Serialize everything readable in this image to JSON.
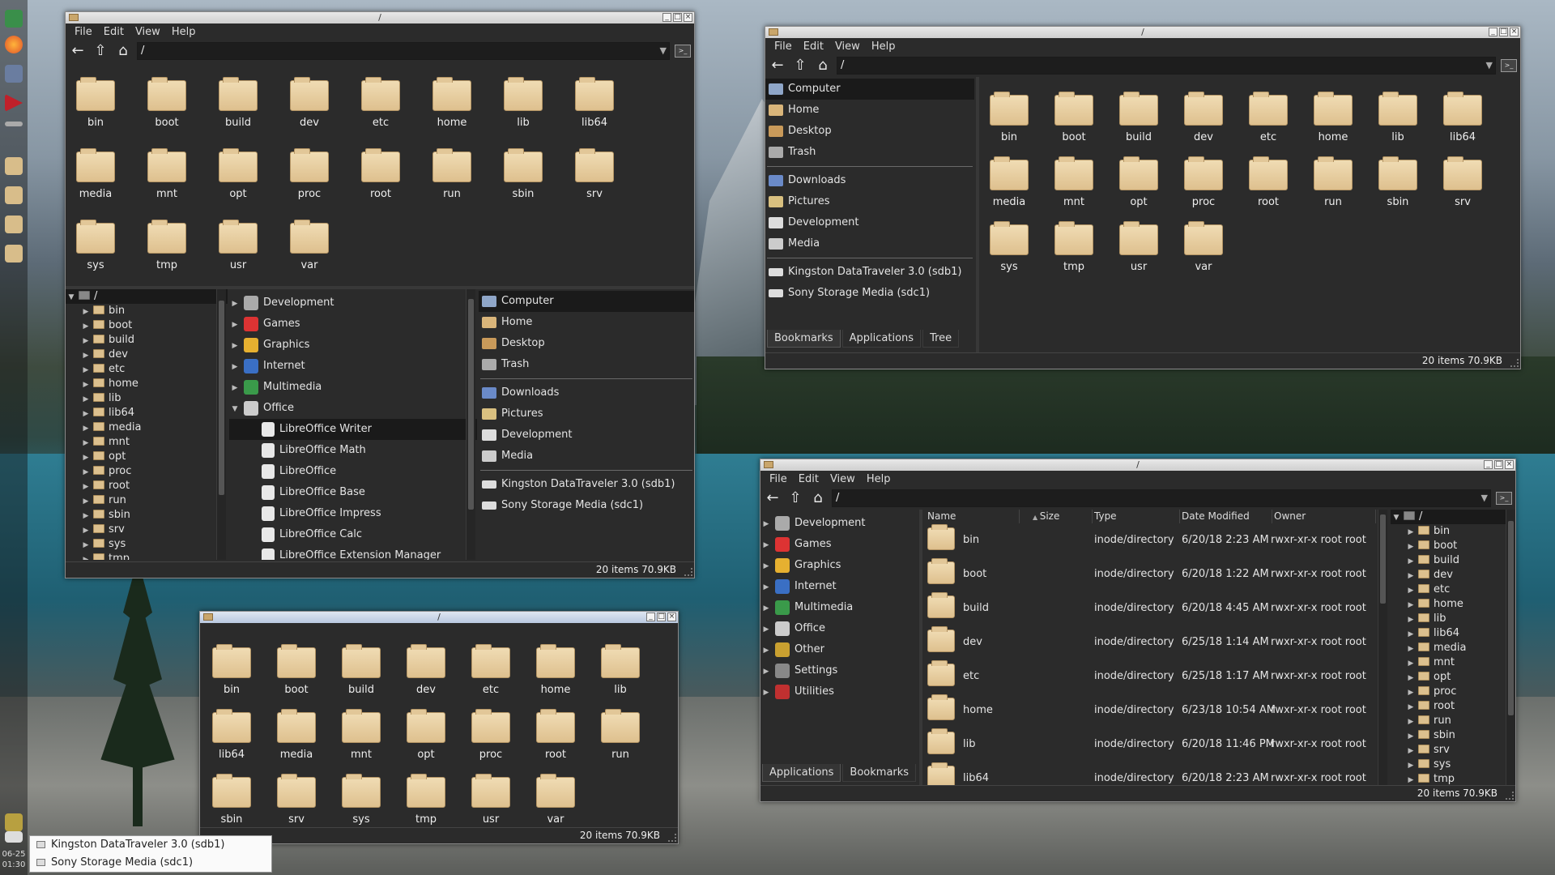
{
  "desktop": {
    "clock": {
      "date": "06-25",
      "time": "01:30"
    },
    "dock_icons": [
      "workspace-icon",
      "firefox-icon",
      "filemanager-icon",
      "media-icon",
      "folder-icon",
      "folder-icon",
      "folder-icon",
      "folder-icon",
      "network-icon",
      "drive-icon"
    ]
  },
  "menus": [
    "File",
    "Edit",
    "View",
    "Help"
  ],
  "path": "/",
  "title": "/",
  "status": "20 items  70.9KB",
  "folders20": [
    "bin",
    "boot",
    "build",
    "dev",
    "etc",
    "home",
    "lib",
    "lib64",
    "media",
    "mnt",
    "opt",
    "proc",
    "root",
    "run",
    "sbin",
    "srv",
    "sys",
    "tmp",
    "usr",
    "var"
  ],
  "tree_items": [
    "bin",
    "boot",
    "build",
    "dev",
    "etc",
    "home",
    "lib",
    "lib64",
    "media",
    "mnt",
    "opt",
    "proc",
    "root",
    "run",
    "sbin",
    "srv",
    "sys",
    "tmp"
  ],
  "tree_root": "/",
  "apps": {
    "categories": [
      "Development",
      "Games",
      "Graphics",
      "Internet",
      "Multimedia",
      "Office"
    ],
    "office_items": [
      "LibreOffice Writer",
      "LibreOffice Math",
      "LibreOffice",
      "LibreOffice Base",
      "LibreOffice Impress",
      "LibreOffice Calc",
      "LibreOffice Extension Manager"
    ],
    "categories_full": [
      "Development",
      "Games",
      "Graphics",
      "Internet",
      "Multimedia",
      "Office",
      "Other",
      "Settings",
      "Utilities"
    ]
  },
  "places": {
    "main": [
      "Computer",
      "Home",
      "Desktop",
      "Trash"
    ],
    "bookmarks": [
      "Downloads",
      "Pictures",
      "Development",
      "Media"
    ],
    "devices": [
      "Kingston DataTraveler 3.0 (sdb1)",
      "Sony Storage Media (sdc1)"
    ]
  },
  "tabs_w2": [
    "Bookmarks",
    "Applications",
    "Tree"
  ],
  "tabs_w4": [
    "Applications",
    "Bookmarks"
  ],
  "detail": {
    "columns": [
      "Name",
      "Size",
      "Type",
      "Date Modified",
      "Owner"
    ],
    "rows": [
      {
        "name": "bin",
        "type": "inode/directory",
        "date": "6/20/18 2:23 AM",
        "owner": "rwxr-xr-x root root"
      },
      {
        "name": "boot",
        "type": "inode/directory",
        "date": "6/20/18 1:22 AM",
        "owner": "rwxr-xr-x root root"
      },
      {
        "name": "build",
        "type": "inode/directory",
        "date": "6/20/18 4:45 AM",
        "owner": "rwxr-xr-x root root"
      },
      {
        "name": "dev",
        "type": "inode/directory",
        "date": "6/25/18 1:14 AM",
        "owner": "rwxr-xr-x root root"
      },
      {
        "name": "etc",
        "type": "inode/directory",
        "date": "6/25/18 1:17 AM",
        "owner": "rwxr-xr-x root root"
      },
      {
        "name": "home",
        "type": "inode/directory",
        "date": "6/23/18 10:54 AM",
        "owner": "rwxr-xr-x root root"
      },
      {
        "name": "lib",
        "type": "inode/directory",
        "date": "6/20/18 11:46 PM",
        "owner": "rwxr-xr-x root root"
      },
      {
        "name": "lib64",
        "type": "inode/directory",
        "date": "6/20/18 2:23 AM",
        "owner": "rwxr-xr-x root root"
      }
    ]
  },
  "popup_devices": [
    "Kingston DataTraveler 3.0 (sdb1)",
    "Sony Storage Media (sdc1)"
  ]
}
